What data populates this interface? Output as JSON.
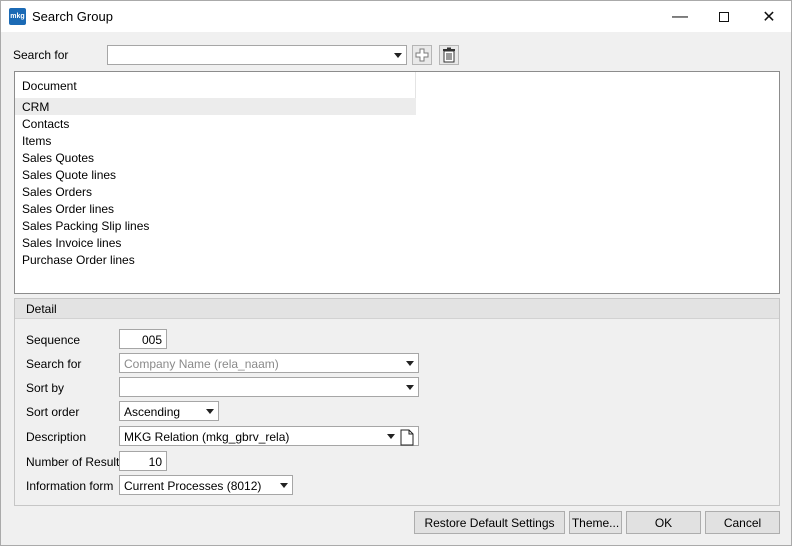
{
  "window": {
    "title": "Search Group",
    "app_icon_text": "mkg"
  },
  "titlebar_controls": {
    "minimize": "—",
    "close": "✕"
  },
  "search": {
    "label": "Search for",
    "value": ""
  },
  "list": {
    "column_header": "Document",
    "items": [
      "CRM",
      "Contacts",
      "Items",
      "Sales Quotes",
      "Sales Quote lines",
      "Sales Orders",
      "Sales Order lines",
      "Sales Packing Slip lines",
      "Sales Invoice lines",
      "Purchase Order lines"
    ],
    "selected_index": 0
  },
  "detail": {
    "header": "Detail",
    "sequence": {
      "label": "Sequence",
      "value": "005"
    },
    "search_for": {
      "label": "Search for",
      "value": "Company Name (rela_naam)"
    },
    "sort_by": {
      "label": "Sort by",
      "value": ""
    },
    "sort_order": {
      "label": "Sort order",
      "value": "Ascending"
    },
    "description": {
      "label": "Description",
      "value": "MKG Relation (mkg_gbrv_rela)"
    },
    "number_of_results": {
      "label": "Number of Results",
      "value": "10"
    },
    "information_form": {
      "label": "Information form",
      "value": "Current Processes (8012)"
    }
  },
  "buttons": {
    "restore": "Restore Default Settings",
    "theme": "Theme...",
    "ok": "OK",
    "cancel": "Cancel"
  },
  "icons": {
    "app": "mkg-app-icon",
    "add": "plus-icon",
    "delete": "trash-icon",
    "description_doc": "document-icon"
  },
  "colors": {
    "app_icon": "#1b6ab5",
    "selected_row": "#ececec"
  }
}
